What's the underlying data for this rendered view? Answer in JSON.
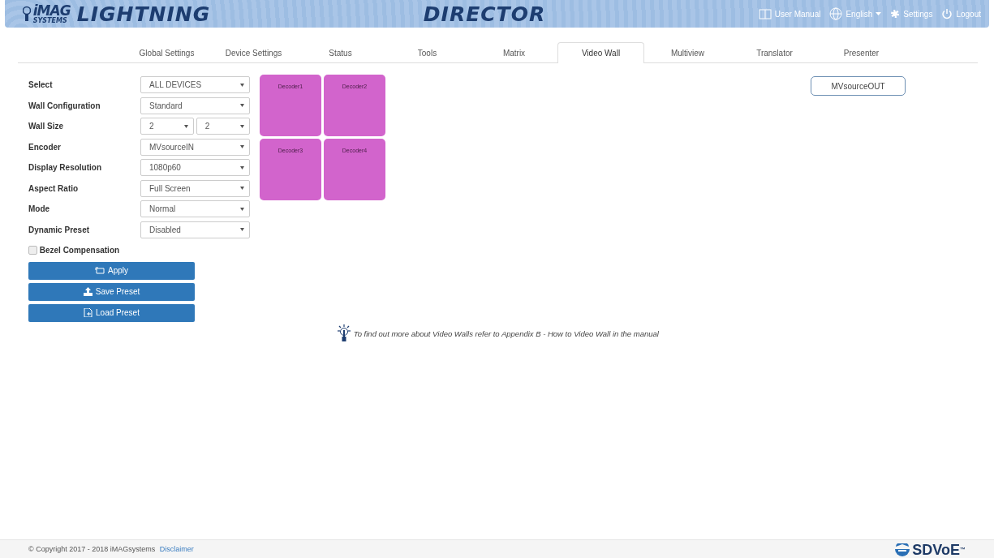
{
  "header": {
    "logo": {
      "brand": "iMAG",
      "sub": "SYSTEMS",
      "product": "LIGHTNING"
    },
    "title": "DIRECTOR",
    "links": [
      {
        "kind": "manual",
        "label": "User Manual"
      },
      {
        "kind": "language",
        "label": "English"
      },
      {
        "kind": "settings",
        "label": "Settings"
      },
      {
        "kind": "logout",
        "label": "Logout"
      }
    ]
  },
  "tabs": [
    {
      "label": "Global Settings",
      "selected": false
    },
    {
      "label": "Device Settings",
      "selected": false
    },
    {
      "label": "Status",
      "selected": false
    },
    {
      "label": "Tools",
      "selected": false
    },
    {
      "label": "Matrix",
      "selected": false
    },
    {
      "label": "Video Wall",
      "selected": true
    },
    {
      "label": "Multiview",
      "selected": false
    },
    {
      "label": "Translator",
      "selected": false
    },
    {
      "label": "Presenter",
      "selected": false
    }
  ],
  "form": {
    "fields": [
      {
        "label": "Select",
        "selects": [
          "ALL DEVICES"
        ]
      },
      {
        "label": "Wall Configuration",
        "selects": [
          "Standard"
        ]
      },
      {
        "label": "Wall Size",
        "selects": [
          "2",
          "2"
        ]
      },
      {
        "label": "Encoder",
        "selects": [
          "MVsourceIN"
        ]
      },
      {
        "label": "Display Resolution",
        "selects": [
          "1080p60"
        ]
      },
      {
        "label": "Aspect Ratio",
        "selects": [
          "Full Screen"
        ]
      },
      {
        "label": "Mode",
        "selects": [
          "Normal"
        ]
      },
      {
        "label": "Dynamic Preset",
        "selects": [
          "Disabled"
        ]
      }
    ],
    "checkbox": {
      "label": "Bezel Compensation",
      "checked": false
    },
    "buttons": [
      {
        "kind": "apply",
        "label": "Apply"
      },
      {
        "kind": "save",
        "label": "Save Preset"
      },
      {
        "kind": "load",
        "label": "Load Preset"
      }
    ]
  },
  "wall": {
    "decoders": [
      "Decoder1",
      "Decoder2",
      "Decoder3",
      "Decoder4"
    ]
  },
  "outputs": [
    "MVsourceOUT"
  ],
  "hint": "To find out more about Video Walls refer to Appendix B - How to Video Wall in the manual",
  "footer": {
    "copyright": "© Copyright 2017 - 2018 iMAGsystems",
    "link": "Disclaimer",
    "brand": "SDVoE",
    "trademark": "™"
  }
}
